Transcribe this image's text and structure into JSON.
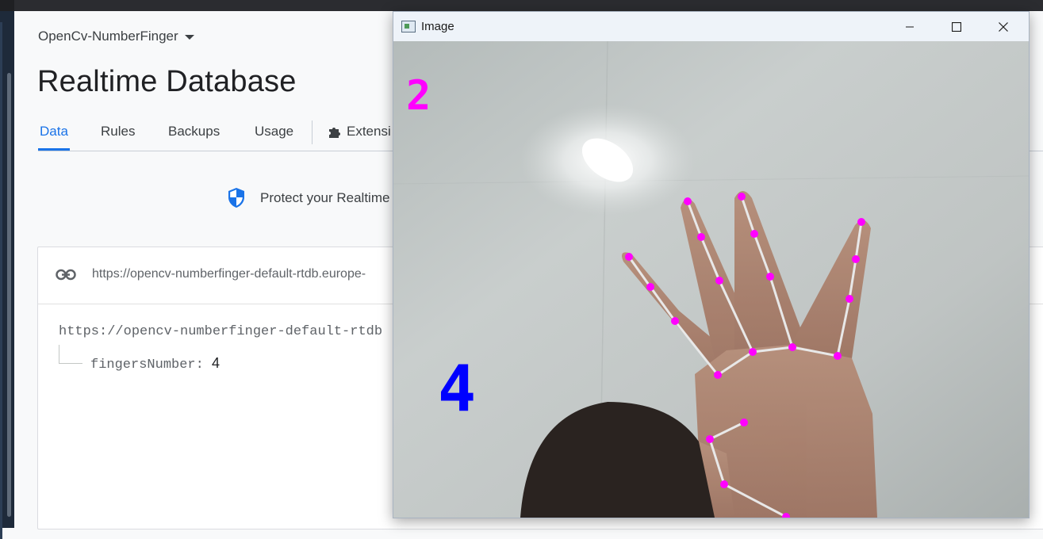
{
  "console": {
    "project_name": "OpenCv-NumberFinger",
    "page_title": "Realtime Database",
    "tabs": [
      {
        "label": "Data",
        "active": true
      },
      {
        "label": "Rules"
      },
      {
        "label": "Backups"
      },
      {
        "label": "Usage"
      },
      {
        "label": "Extensi",
        "icon": "puzzle-icon"
      }
    ],
    "protect_text": "Protect your Realtime",
    "url_bar": "https://opencv-numberfinger-default-rtdb.europe-",
    "tree": {
      "root": "https://opencv-numberfinger-default-rtdb",
      "child_key": "fingersNumber",
      "child_sep": ": ",
      "child_value": "4"
    }
  },
  "cv_window": {
    "title": "Image",
    "overlay_top_number": "2",
    "overlay_count": "4"
  },
  "colors": {
    "accent": "#1a73e8",
    "landmark": "#ff00ff",
    "count_text": "#0000ff"
  }
}
